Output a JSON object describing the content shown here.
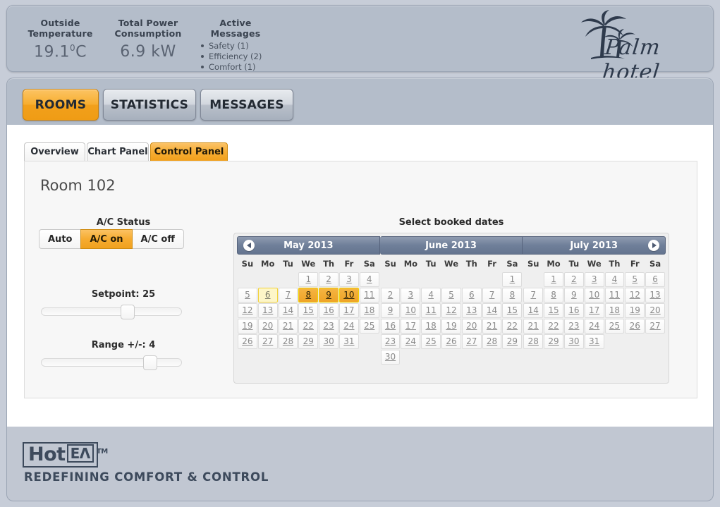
{
  "header": {
    "stats": [
      {
        "title_line1": "Outside",
        "title_line2": "Temperature",
        "value": "19.1",
        "unit": "0C"
      },
      {
        "title_line1": "Total Power",
        "title_line2": "Consumption",
        "value": "6.9 kW",
        "unit": ""
      },
      {
        "title_line1": "Active",
        "title_line2": "Messages",
        "value": "",
        "unit": ""
      }
    ],
    "temperature": "19.1",
    "temperature_unit": "0",
    "temperature_scale": "C",
    "power": "6.9 kW",
    "messages": [
      "Safety (1)",
      "Efficiency (2)",
      "Comfort (1)"
    ],
    "brand": "Palm hotel"
  },
  "nav": {
    "items": [
      {
        "label": "ROOMS",
        "active": true
      },
      {
        "label": "STATISTICS",
        "active": false
      },
      {
        "label": "MESSAGES",
        "active": false
      }
    ]
  },
  "subtabs": {
    "items": [
      {
        "label": "Overview",
        "active": false
      },
      {
        "label": "Chart Panel",
        "active": false
      },
      {
        "label": "Control Panel",
        "active": true
      }
    ]
  },
  "panel": {
    "room_title": "Room 102",
    "ac_status_label": "A/C Status",
    "ac_buttons": [
      {
        "label": "Auto",
        "active": false
      },
      {
        "label": "A/C on",
        "active": true
      },
      {
        "label": "A/C off",
        "active": false
      }
    ],
    "setpoint_label": "Setpoint: 25",
    "setpoint_value": 25,
    "setpoint_percent": 62,
    "range_label": "Range +/-: 4",
    "range_value": 4,
    "range_percent": 80,
    "calendar_heading": "Select booked dates"
  },
  "calendar": {
    "weekdays": [
      "Su",
      "Mo",
      "Tu",
      "We",
      "Th",
      "Fr",
      "Sa"
    ],
    "prev_arrow": "prev-month-arrow",
    "next_arrow": "next-month-arrow",
    "months": [
      {
        "title": "May 2013",
        "lead_blanks": 3,
        "days": 31,
        "selected": [
          8,
          9,
          10
        ],
        "highlight": [
          6
        ]
      },
      {
        "title": "June 2013",
        "lead_blanks": 6,
        "days": 30,
        "selected": [],
        "highlight": []
      },
      {
        "title": "July 2013",
        "lead_blanks": 1,
        "days": 31,
        "selected": [],
        "highlight": []
      }
    ]
  },
  "footer": {
    "logo_main": "Hot",
    "logo_boxed": "ЕΛ",
    "logo_tm": "TM",
    "tagline": "REDEFINING COMFORT & CONTROL"
  }
}
